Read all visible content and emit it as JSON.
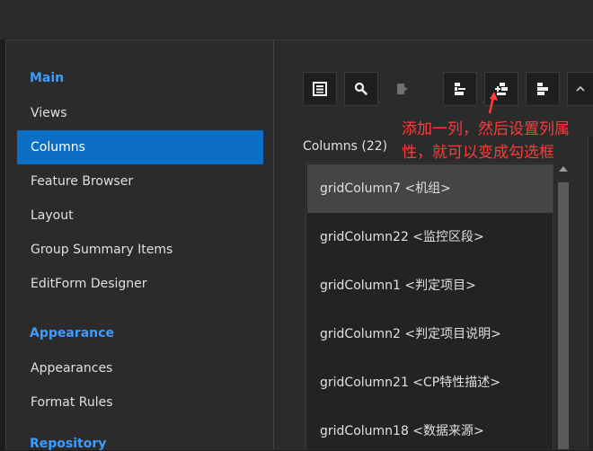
{
  "sidebar": {
    "sections": [
      {
        "title": "Main"
      },
      {
        "title": "Appearance"
      },
      {
        "title": "Repository"
      }
    ],
    "main_items": [
      {
        "label": "Views"
      },
      {
        "label": "Columns"
      },
      {
        "label": "Feature Browser"
      },
      {
        "label": "Layout"
      },
      {
        "label": "Group Summary Items"
      },
      {
        "label": "EditForm Designer"
      }
    ],
    "appearance_items": [
      {
        "label": "Appearances"
      },
      {
        "label": "Format Rules"
      }
    ],
    "active_item": "Columns"
  },
  "toolbar": {
    "buttons": [
      {
        "icon": "column-list-icon"
      },
      {
        "icon": "search-icon"
      },
      {
        "icon": "export-icon"
      },
      {
        "icon": "add-column-icon"
      },
      {
        "icon": "insert-column-icon"
      },
      {
        "icon": "remove-column-icon"
      },
      {
        "icon": "chevron-up-icon"
      }
    ]
  },
  "columns": {
    "header": "Columns (22)",
    "items": [
      {
        "label": "gridColumn7 <机组>"
      },
      {
        "label": "gridColumn22 <监控区段>"
      },
      {
        "label": "gridColumn1 <判定项目>"
      },
      {
        "label": "gridColumn2 <判定项目说明>"
      },
      {
        "label": "gridColumn21 <CP特性描述>"
      },
      {
        "label": "gridColumn18 <数据来源>"
      }
    ],
    "selected_index": 0
  },
  "annotation": {
    "text": "添加一列，然后设置列属性，就可以变成勾选框",
    "color": "#ff3b3b"
  },
  "colors": {
    "accent": "#0d6ec6",
    "section_title": "#3c9dff",
    "background": "#2b2b2b"
  }
}
